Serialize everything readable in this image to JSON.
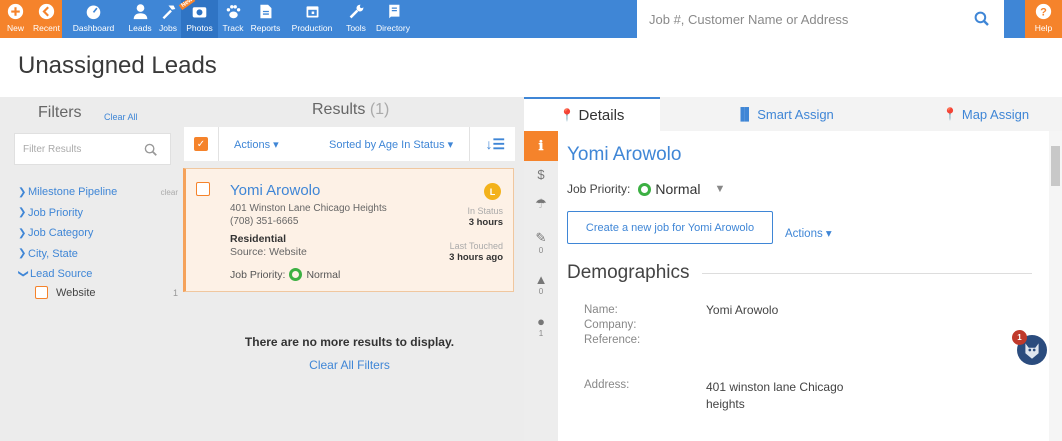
{
  "nav": {
    "items": [
      {
        "label": "New",
        "icon": "plus-circle-icon"
      },
      {
        "label": "Recent",
        "icon": "back-arrow-icon"
      },
      {
        "label": "Dashboard",
        "icon": "gauge-icon"
      },
      {
        "label": "Leads",
        "icon": "user-icon"
      },
      {
        "label": "Jobs",
        "icon": "hammer-icon"
      },
      {
        "label": "Photos",
        "icon": "camera-icon",
        "badge": "New"
      },
      {
        "label": "Track",
        "icon": "paw-icon"
      },
      {
        "label": "Reports",
        "icon": "document-icon"
      },
      {
        "label": "Production",
        "icon": "calendar-icon"
      },
      {
        "label": "Tools",
        "icon": "wrench-icon"
      },
      {
        "label": "Directory",
        "icon": "book-icon"
      }
    ],
    "search_placeholder": "Job #, Customer Name or Address",
    "help_label": "Help"
  },
  "page": {
    "title": "Unassigned Leads"
  },
  "filters": {
    "heading": "Filters",
    "clear_all": "Clear All",
    "search_placeholder": "Filter Results",
    "groups": [
      {
        "label": "Milestone Pipeline",
        "clear": "clear",
        "expanded": false
      },
      {
        "label": "Job Priority",
        "expanded": false
      },
      {
        "label": "Job Category",
        "expanded": false
      },
      {
        "label": "City, State",
        "expanded": false
      },
      {
        "label": "Lead Source",
        "expanded": true
      }
    ],
    "lead_source_options": [
      {
        "label": "Website",
        "count": "1"
      }
    ]
  },
  "results": {
    "heading": "Results",
    "count": "(1)",
    "actions_label": "Actions ▾",
    "sort_label": "Sorted by Age In Status ▾",
    "card": {
      "name": "Yomi Arowolo",
      "address": "401 Winston Lane Chicago Heights",
      "phone": "(708) 351-6665",
      "type": "Residential",
      "source": "Source: Website",
      "priority_label": "Job Priority:",
      "priority_value": "Normal",
      "badge": "L",
      "in_status_label": "In Status",
      "in_status_value": "3 hours",
      "last_touched_label": "Last Touched",
      "last_touched_value": "3 hours ago"
    },
    "no_more": "There are no more results to display.",
    "clear_filters": "Clear All Filters"
  },
  "details": {
    "tabs": [
      {
        "label": "Details",
        "icon": "map-pin-icon"
      },
      {
        "label": "Smart Assign",
        "icon": "bar-chart-icon"
      },
      {
        "label": "Map Assign",
        "icon": "map-pin-icon"
      }
    ],
    "side": [
      {
        "icon": "info-icon",
        "count": ""
      },
      {
        "icon": "dollar-icon",
        "count": ""
      },
      {
        "icon": "umbrella-icon",
        "count": ""
      },
      {
        "icon": "pin-icon",
        "count": "0"
      },
      {
        "icon": "bell-icon",
        "count": "0"
      },
      {
        "icon": "comment-icon",
        "count": "1"
      }
    ],
    "name": "Yomi Arowolo",
    "job_priority_label": "Job Priority:",
    "job_priority_value": "Normal",
    "create_button": "Create a new job for Yomi Arowolo",
    "actions_label": "Actions ▾",
    "demographics_heading": "Demographics",
    "fields": {
      "name_label": "Name:",
      "company_label": "Company:",
      "reference_label": "Reference:",
      "name_value": "Yomi Arowolo",
      "address_label": "Address:",
      "address_value": "401 winston lane Chicago heights"
    },
    "notification_count": "1"
  },
  "colors": {
    "primary": "#3f86d6",
    "accent": "#f5832b",
    "priority_normal": "#3cb043"
  }
}
